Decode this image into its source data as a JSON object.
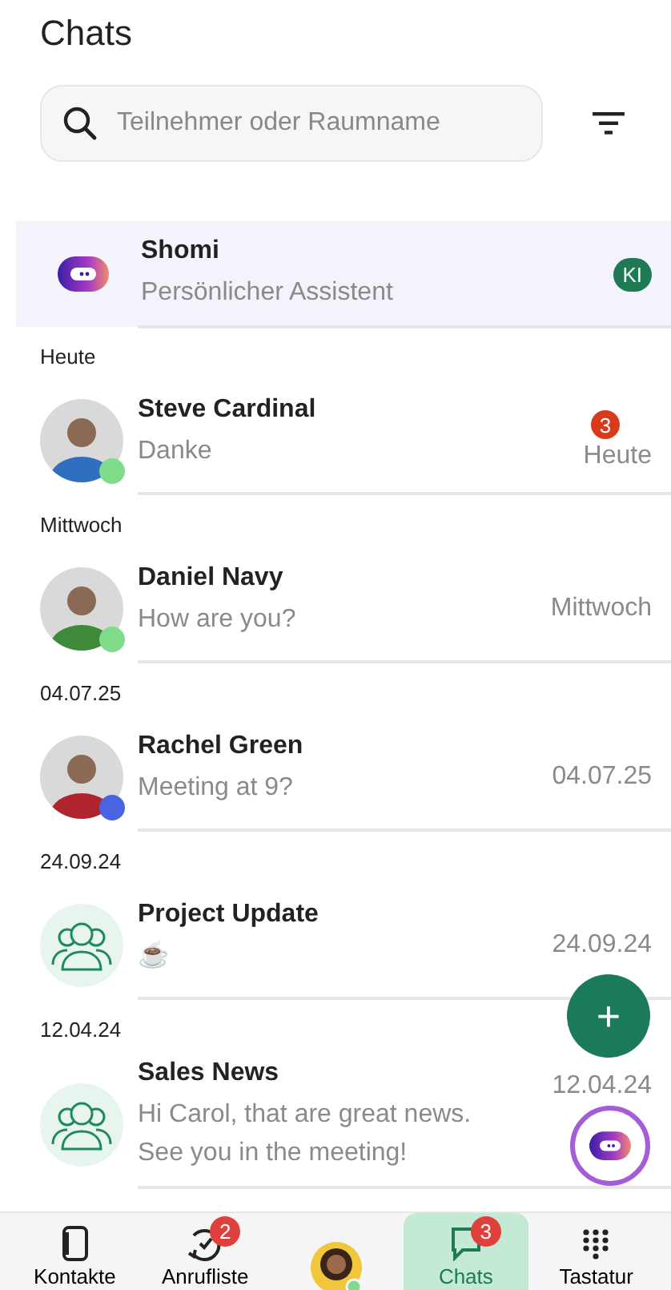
{
  "title": "Chats",
  "search": {
    "placeholder": "Teilnehmer oder Raumname"
  },
  "assistant": {
    "name": "Shomi",
    "subtitle": "Persönlicher Assistent",
    "tag": "KI"
  },
  "sections": [
    {
      "label": "Heute",
      "chat": {
        "kind": "person",
        "name": "Steve Cardinal",
        "preview": "Danke",
        "date": "Heute",
        "unread": "3",
        "color": "#7edc8a"
      }
    },
    {
      "label": "Mittwoch",
      "chat": {
        "kind": "person",
        "name": "Daniel Navy",
        "preview": "How are you?",
        "date": "Mittwoch",
        "color": "#7edc8a"
      }
    },
    {
      "label": "04.07.25",
      "chat": {
        "kind": "person",
        "name": "Rachel Green",
        "preview": "Meeting at 9?",
        "date": "04.07.25",
        "color": "#4a63e0"
      }
    },
    {
      "label": "24.09.24",
      "chat": {
        "kind": "group",
        "name": "Project Update",
        "preview": "☕",
        "date": "24.09.24"
      }
    },
    {
      "label": "12.04.24",
      "chat": {
        "kind": "group",
        "name": "Sales News",
        "preview": "Hi Carol, that are great news. See you in the meeting!",
        "date": "12.04.24"
      }
    }
  ],
  "fab": {
    "label": "+"
  },
  "nav": [
    {
      "kind": "contacts",
      "label": "Kontakte",
      "selected": false
    },
    {
      "kind": "calls",
      "label": "Anrufliste",
      "badge": "2",
      "selected": false
    },
    {
      "kind": "profile",
      "selected": false
    },
    {
      "kind": "chats",
      "label": "Chats",
      "badge": "3",
      "selected": true
    },
    {
      "kind": "keypad",
      "label": "Tastatur",
      "selected": false
    }
  ]
}
